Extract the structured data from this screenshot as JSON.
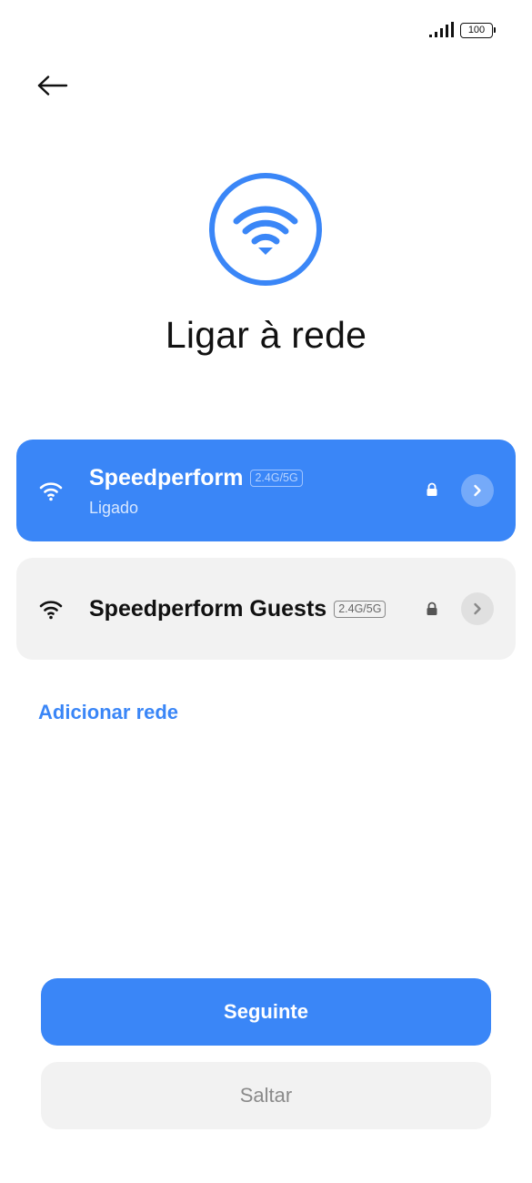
{
  "status_bar": {
    "battery_level": "100"
  },
  "page": {
    "title": "Ligar à rede"
  },
  "networks": [
    {
      "name": "Speedperform",
      "band": "2.4G/5G",
      "status": "Ligado",
      "secured": true,
      "connected": true
    },
    {
      "name": "Speedperform Guests",
      "band": "2.4G/5G",
      "status": "",
      "secured": true,
      "connected": false
    }
  ],
  "add_network_label": "Adicionar rede",
  "buttons": {
    "next_label": "Seguinte",
    "skip_label": "Saltar"
  },
  "colors": {
    "accent": "#3a86f7",
    "card_inactive": "#f2f2f2"
  }
}
